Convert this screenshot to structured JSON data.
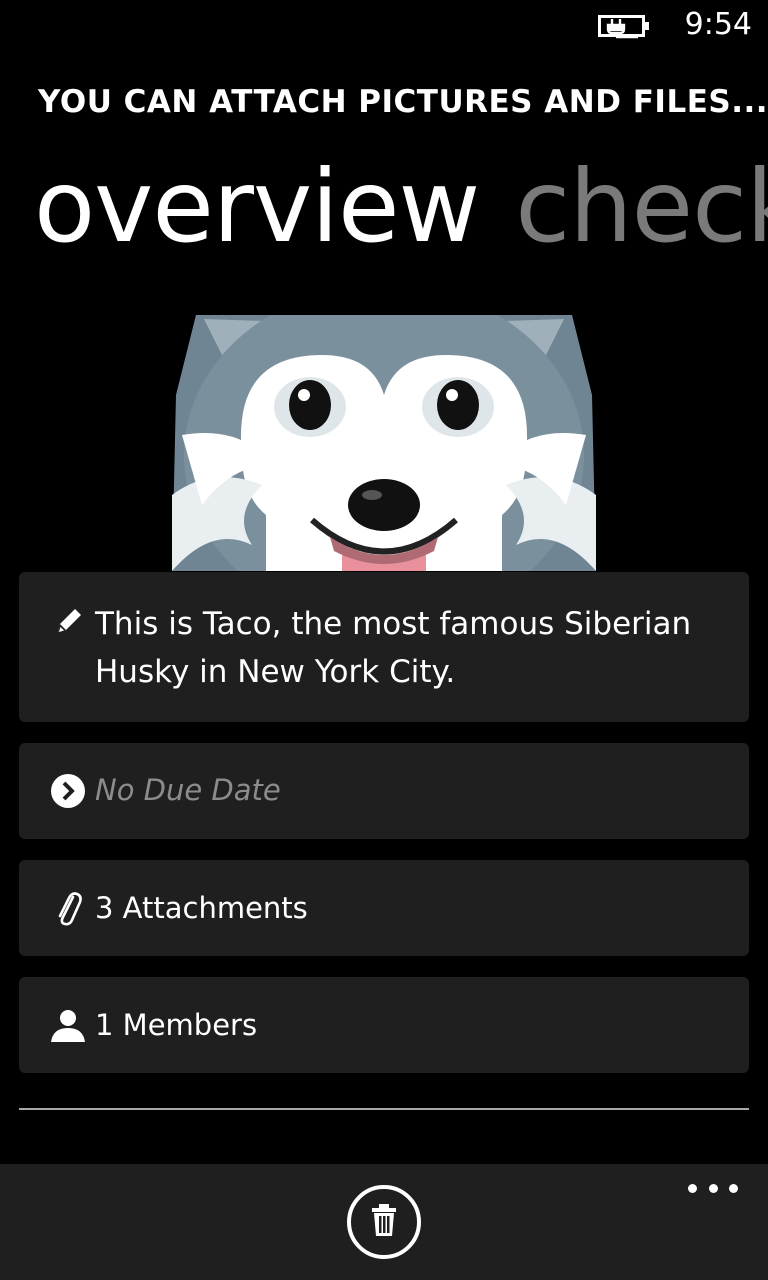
{
  "status_bar": {
    "time": "9:54",
    "battery_icon": "battery-charging-icon"
  },
  "header": {
    "app_title": "YOU CAN ATTACH PICTURES AND FILES...",
    "pivot": [
      {
        "label": "overview",
        "active": true
      },
      {
        "label": "check",
        "active": false
      }
    ]
  },
  "cover": {
    "icon": "husky-image"
  },
  "details": {
    "description": {
      "icon": "pencil-icon",
      "text": "This is Taco, the most famous Siberian Husky in New York City."
    },
    "due_date": {
      "icon": "chevron-circle-icon",
      "text": "No Due Date"
    },
    "attachments": {
      "icon": "paperclip-icon",
      "text": "3 Attachments"
    },
    "members": {
      "icon": "person-icon",
      "text": "1 Members"
    }
  },
  "app_bar": {
    "delete_icon": "trash-icon",
    "more_icon": "ellipsis-icon"
  },
  "colors": {
    "background": "#000000",
    "card": "#1f1f1f",
    "muted_text": "#8c8c8c",
    "inactive_pivot": "#7a7a7a"
  }
}
